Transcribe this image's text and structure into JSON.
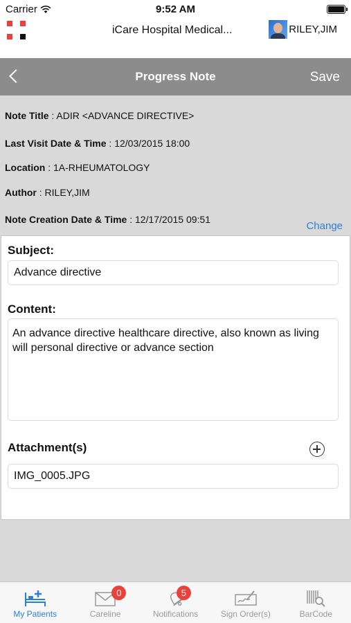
{
  "status_bar": {
    "carrier": "Carrier",
    "time": "9:52 AM"
  },
  "app_header": {
    "title": "iCare Hospital Medical...",
    "user_name": "RILEY,JIM"
  },
  "nav": {
    "title": "Progress Note",
    "save_label": "Save"
  },
  "note_info": [
    {
      "key": "Note Title",
      "value": " : ADIR  <ADVANCE DIRECTIVE>"
    },
    {
      "key": "Last Visit Date & Time",
      "value": " : 12/03/2015 18:00"
    },
    {
      "key": "Location",
      "value": " : 1A-RHEUMATOLOGY"
    },
    {
      "key": "Author",
      "value": " : RILEY,JIM"
    },
    {
      "key": "Note Creation Date & Time",
      "value": " : 12/17/2015 09:51"
    }
  ],
  "change_label": "Change",
  "form": {
    "subject_label": "Subject:",
    "subject_value": "Advance directive",
    "content_label": "Content:",
    "content_value": "An advance directive healthcare directive, also known as living will personal directive or advance section",
    "attachments_label": "Attachment(s)",
    "attachment_file": "IMG_0005.JPG"
  },
  "tab_bar": [
    {
      "label": "My Patients",
      "icon": "patient-bed-icon",
      "active": true
    },
    {
      "label": "Careline",
      "icon": "mail-icon",
      "badge": "0"
    },
    {
      "label": "Notifications",
      "icon": "bell-icon",
      "badge": "5"
    },
    {
      "label": "Sign Order(s)",
      "icon": "signature-icon"
    },
    {
      "label": "BarCode",
      "icon": "barcode-scan-icon"
    }
  ],
  "colors": {
    "accent": "#2d7ed8",
    "nav_bar": "#8c8c8c",
    "badge": "#e8423b",
    "logo_red": "#e8423b",
    "logo_black": "#111111"
  }
}
